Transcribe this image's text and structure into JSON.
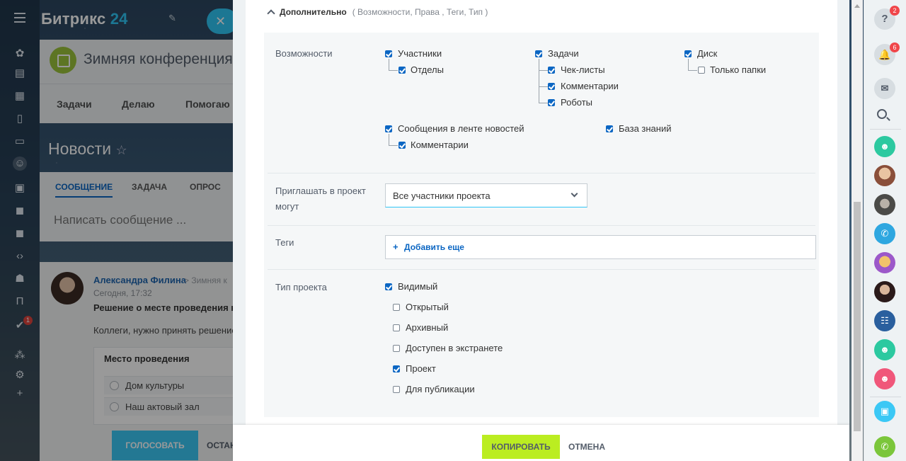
{
  "portal": {
    "logo_main": "Битрикс",
    "logo_num": "24",
    "close_glyph": "✕",
    "group": {
      "title": "Зимняя конференция",
      "tabs": [
        "Задачи",
        "Делаю",
        "Помогаю"
      ]
    },
    "news_title": "Новости",
    "star_glyph": "☆",
    "poster": {
      "tabs": [
        "СООБЩЕНИЕ",
        "ЗАДАЧА",
        "ОПРОС"
      ],
      "placeholder": "Написать сообщение ..."
    },
    "feed": {
      "author": "Александра Филина",
      "destination": "> Зимняя к",
      "time": "Сегодня, 17:32",
      "subject": "Решение о месте проведения ко",
      "text": "Коллеги, нужно принять решение",
      "vote_title": "Место проведения",
      "options": [
        "Дом культуры",
        "Наш актовый зал"
      ],
      "vote_button": "ГОЛОСОВАТЬ",
      "stop_button": "ОСТАН"
    },
    "leftnav_badge": "1",
    "leftnav_letter": "П"
  },
  "slider": {
    "section": {
      "title": "Дополнительно",
      "hint": "( Возможности,  Права , Теги,  Тип  )"
    },
    "features": {
      "label": "Возможности",
      "items": [
        {
          "label": "Участники",
          "checked": true
        },
        {
          "label": "Отделы",
          "checked": true
        },
        {
          "label": "Задачи",
          "checked": true
        },
        {
          "label": "Чек-листы",
          "checked": true
        },
        {
          "label": "Комментарии",
          "checked": true
        },
        {
          "label": "Роботы",
          "checked": true
        },
        {
          "label": "Диск",
          "checked": true
        },
        {
          "label": "Только папки",
          "checked": false
        },
        {
          "label": "Сообщения в ленте новостей",
          "checked": true
        },
        {
          "label": "Комментарии",
          "checked": true
        },
        {
          "label": "База знаний",
          "checked": true
        }
      ]
    },
    "invite": {
      "label": "Приглашать в проект могут",
      "value": "Все участники проекта"
    },
    "tags": {
      "label": "Теги",
      "plus": "+",
      "add": "Добавить еще"
    },
    "type": {
      "label": "Тип проекта",
      "items": [
        {
          "label": "Видимый",
          "checked": true
        },
        {
          "label": "Открытый",
          "checked": false
        },
        {
          "label": "Архивный",
          "checked": false
        },
        {
          "label": "Доступен в экстранете",
          "checked": false
        },
        {
          "label": "Проект",
          "checked": true
        },
        {
          "label": "Для публикации",
          "checked": false
        }
      ]
    },
    "footer": {
      "copy": "КОПИРОВАТЬ",
      "cancel": "ОТМЕНА"
    }
  },
  "rightbar": {
    "help_glyph": "?",
    "help_badge": "2",
    "notif_badge": "6"
  },
  "colors": {
    "accent": "#2fc6f6",
    "link": "#0b66c3",
    "copy_button": "#bbed21",
    "badge": "#f0464a"
  }
}
